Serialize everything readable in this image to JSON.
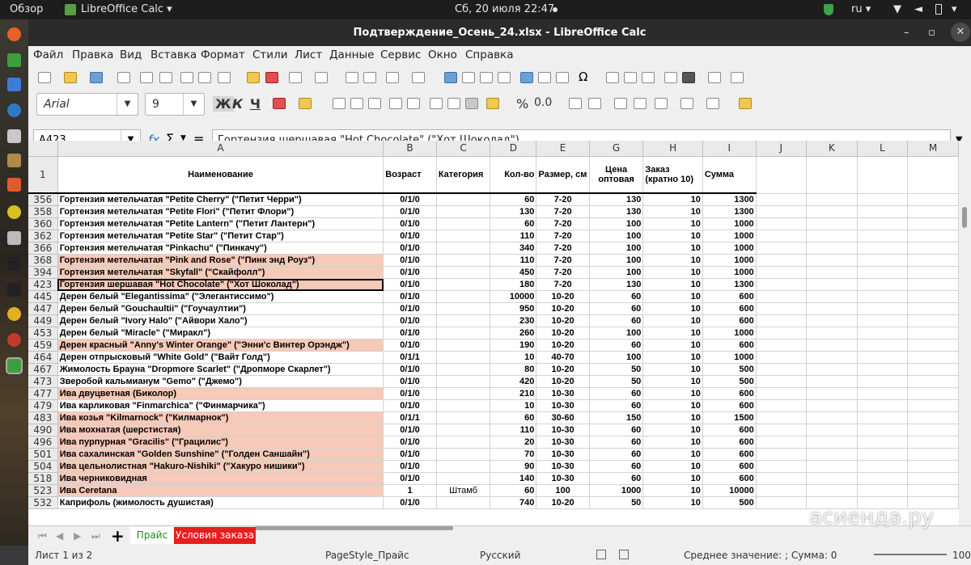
{
  "topbar": {
    "activities": "Обзор",
    "app_name": "LibreOffice Calc",
    "datetime": "Сб, 20 июля  22:47",
    "lang": "ru"
  },
  "window": {
    "title": "Подтверждение_Осень_24.xlsx - LibreOffice Calc",
    "minimize": "–",
    "restore": "▫",
    "close": "✕"
  },
  "menu": [
    "Файл",
    "Правка",
    "Вид",
    "Вставка",
    "Формат",
    "Стили",
    "Лист",
    "Данные",
    "Сервис",
    "Окно",
    "Справка"
  ],
  "format_bar": {
    "font_name": "Arial",
    "font_size": "9",
    "bold": "Ж",
    "italic": "К",
    "underline": "Ч",
    "percent": "%",
    "decimal": "0.0"
  },
  "formula_bar": {
    "cell_ref": "A423",
    "fx": "fx",
    "sum": "Σ",
    "equals": "=",
    "content": "Гортензия шершавая \"Hot Chocolate\" (\"Хот Шоколад\")"
  },
  "columns": [
    "A",
    "B",
    "C",
    "D",
    "E",
    "G",
    "H",
    "I",
    "J",
    "K",
    "L",
    "M"
  ],
  "header_row": {
    "row_num": "1",
    "a": "Наименование",
    "b": "Возраст",
    "c": "Категория",
    "d": "Кол-во",
    "e": "Размер, см",
    "g": "Цена оптовая",
    "h": "Заказ (кратно 10)",
    "i": "Сумма"
  },
  "rows": [
    {
      "n": "356",
      "a": "Гортензия метельчатая \"Petite Cherry\" (\"Петит Черри\")",
      "b": "0/1/0",
      "c": "",
      "d": "60",
      "e": "7-20",
      "g": "130",
      "h": "10",
      "i": "1300",
      "hl": false
    },
    {
      "n": "358",
      "a": "Гортензия метельчатая \"Petite Flori\" (\"Петит Флори\")",
      "b": "0/1/0",
      "c": "",
      "d": "130",
      "e": "7-20",
      "g": "130",
      "h": "10",
      "i": "1300",
      "hl": false
    },
    {
      "n": "360",
      "a": "Гортензия метельчатая \"Petite Lantern\" (\"Петит Лантерн\")",
      "b": "0/1/0",
      "c": "",
      "d": "60",
      "e": "7-20",
      "g": "100",
      "h": "10",
      "i": "1000",
      "hl": false
    },
    {
      "n": "362",
      "a": "Гортензия метельчатая \"Petite Star\" (\"Петит Стар\")",
      "b": "0/1/0",
      "c": "",
      "d": "110",
      "e": "7-20",
      "g": "100",
      "h": "10",
      "i": "1000",
      "hl": false
    },
    {
      "n": "366",
      "a": "Гортензия метельчатая \"Pinkachu\" (\"Пинкачу\")",
      "b": "0/1/0",
      "c": "",
      "d": "340",
      "e": "7-20",
      "g": "100",
      "h": "10",
      "i": "1000",
      "hl": false
    },
    {
      "n": "368",
      "a": "Гортензия метельчатая \"Pink and Rose\" (\"Пинк энд Роуз\")",
      "b": "0/1/0",
      "c": "",
      "d": "110",
      "e": "7-20",
      "g": "100",
      "h": "10",
      "i": "1000",
      "hl": true
    },
    {
      "n": "394",
      "a": "Гортензия метельчатая \"Skyfall\" (\"Скайфолл\")",
      "b": "0/1/0",
      "c": "",
      "d": "450",
      "e": "7-20",
      "g": "100",
      "h": "10",
      "i": "1000",
      "hl": true
    },
    {
      "n": "423",
      "a": "Гортензия шершавая \"Hot Chocolate\" (\"Хот Шоколад\")",
      "b": "0/1/0",
      "c": "",
      "d": "180",
      "e": "7-20",
      "g": "130",
      "h": "10",
      "i": "1300",
      "hl": true,
      "sel": true
    },
    {
      "n": "445",
      "a": "Дерен белый \"Elegantissima\" (\"Элегантиссимо\")",
      "b": "0/1/0",
      "c": "",
      "d": "10000",
      "e": "10-20",
      "g": "60",
      "h": "10",
      "i": "600",
      "hl": false
    },
    {
      "n": "447",
      "a": "Дерен белый \"Gouchaultii\" (\"Гоучаултии\")",
      "b": "0/1/0",
      "c": "",
      "d": "950",
      "e": "10-20",
      "g": "60",
      "h": "10",
      "i": "600",
      "hl": false
    },
    {
      "n": "449",
      "a": "Дерен белый \"Ivory Halo\" (\"Айвори Хало\")",
      "b": "0/1/0",
      "c": "",
      "d": "230",
      "e": "10-20",
      "g": "60",
      "h": "10",
      "i": "600",
      "hl": false
    },
    {
      "n": "453",
      "a": "Дерен белый \"Miracle\" (\"Миракл\")",
      "b": "0/1/0",
      "c": "",
      "d": "260",
      "e": "10-20",
      "g": "100",
      "h": "10",
      "i": "1000",
      "hl": false
    },
    {
      "n": "459",
      "a": "Дерен красный \"Anny's Winter Orange\" (\"Энни'с Винтер Орэндж\")",
      "b": "0/1/0",
      "c": "",
      "d": "190",
      "e": "10-20",
      "g": "60",
      "h": "10",
      "i": "600",
      "hl": true
    },
    {
      "n": "464",
      "a": "Дерен отпрысковый \"White Gold\" (\"Вайт Голд\")",
      "b": "0/1/1",
      "c": "",
      "d": "10",
      "e": "40-70",
      "g": "100",
      "h": "10",
      "i": "1000",
      "hl": false
    },
    {
      "n": "467",
      "a": "Жимолость Брауна \"Dropmore Scarlet\" (\"Дропморе Скарлет\")",
      "b": "0/1/0",
      "c": "",
      "d": "80",
      "e": "10-20",
      "g": "50",
      "h": "10",
      "i": "500",
      "hl": false
    },
    {
      "n": "473",
      "a": "Зверобой кальмианум \"Gemo\" (\"Джемо\")",
      "b": "0/1/0",
      "c": "",
      "d": "420",
      "e": "10-20",
      "g": "50",
      "h": "10",
      "i": "500",
      "hl": false
    },
    {
      "n": "477",
      "a": "Ива двуцветная (Биколор)",
      "b": "0/1/0",
      "c": "",
      "d": "210",
      "e": "10-30",
      "g": "60",
      "h": "10",
      "i": "600",
      "hl": true
    },
    {
      "n": "479",
      "a": "Ива карликовая \"Finmarchica\" (\"Финмарчика\")",
      "b": "0/1/0",
      "c": "",
      "d": "10",
      "e": "10-30",
      "g": "60",
      "h": "10",
      "i": "600",
      "hl": false
    },
    {
      "n": "483",
      "a": "Ива козья \"Kilmarnock\" (\"Килмарнок\")",
      "b": "0/1/1",
      "c": "",
      "d": "60",
      "e": "30-60",
      "g": "150",
      "h": "10",
      "i": "1500",
      "hl": true
    },
    {
      "n": "490",
      "a": "Ива мохнатая (шерстистая)",
      "b": "0/1/0",
      "c": "",
      "d": "110",
      "e": "10-30",
      "g": "60",
      "h": "10",
      "i": "600",
      "hl": true
    },
    {
      "n": "496",
      "a": "Ива пурпурная \"Gracilis\" (\"Грацилис\")",
      "b": "0/1/0",
      "c": "",
      "d": "20",
      "e": "10-30",
      "g": "60",
      "h": "10",
      "i": "600",
      "hl": true
    },
    {
      "n": "501",
      "a": "Ива сахалинская \"Golden Sunshine\" (\"Голден Саншайн\")",
      "b": "0/1/0",
      "c": "",
      "d": "70",
      "e": "10-30",
      "g": "60",
      "h": "10",
      "i": "600",
      "hl": true
    },
    {
      "n": "504",
      "a": "Ива цельнолистная \"Hakuro-Nishiki\" (\"Хакуро нишики\")",
      "b": "0/1/0",
      "c": "",
      "d": "90",
      "e": "10-30",
      "g": "60",
      "h": "10",
      "i": "600",
      "hl": true
    },
    {
      "n": "518",
      "a": "Ива черниковидная",
      "b": "0/1/0",
      "c": "",
      "d": "140",
      "e": "10-30",
      "g": "60",
      "h": "10",
      "i": "600",
      "hl": true
    },
    {
      "n": "523",
      "a": "Ива Ceretana",
      "b": "1",
      "c": "Штамб",
      "d": "60",
      "e": "100",
      "g": "1000",
      "h": "10",
      "i": "10000",
      "hl": true
    },
    {
      "n": "532",
      "a": "Каприфоль (жимолость душистая)",
      "b": "0/1/0",
      "c": "",
      "d": "740",
      "e": "10-20",
      "g": "50",
      "h": "10",
      "i": "500",
      "hl": false
    }
  ],
  "sheet_tabs": {
    "add": "+",
    "tab1": "Прайс",
    "tab2": "Условия заказа"
  },
  "status": {
    "sheet": "Лист 1 из 2",
    "page_style": "PageStyle_Прайс",
    "language": "Русский",
    "summary": "Среднее значение: ; Сумма: 0",
    "zoom": "100 %"
  },
  "watermark": "асиенда.ру",
  "colors": {
    "highlight": "#f7c9b8",
    "tab_active_text": "#1a8a1a",
    "tab2_bg": "#e81e1e"
  }
}
